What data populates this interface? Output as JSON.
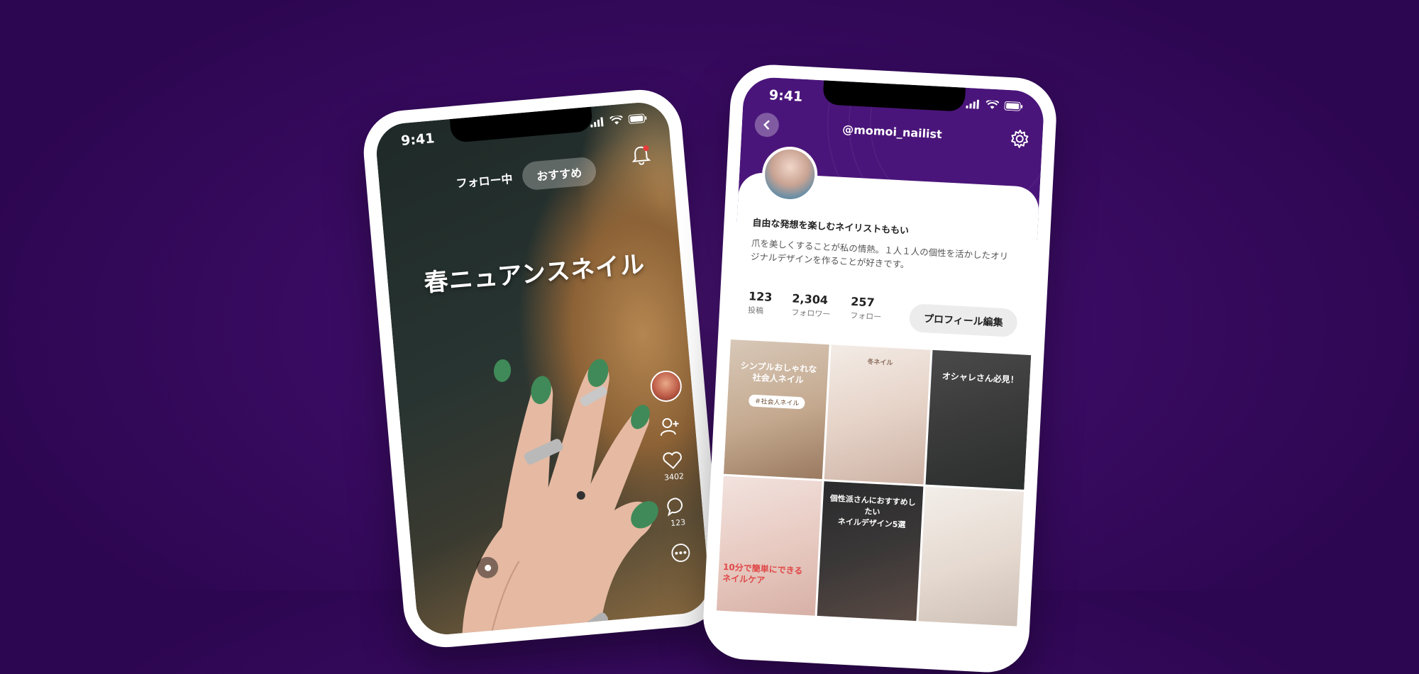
{
  "feed_phone": {
    "status_time": "9:41",
    "tabs": {
      "following": "フォロー中",
      "recommended": "おすすめ"
    },
    "post_title": "春ニュアンスネイル",
    "actions": {
      "like_count": "3402",
      "comment_count": "123"
    }
  },
  "profile_phone": {
    "status_time": "9:41",
    "username": "@momoi_nailist",
    "display_name": "自由な発想を楽しむネイリストももい",
    "bio": "爪を美しくすることが私の情熱。１人１人の個性を活かしたオリジナルデザインを作ることが好きです。",
    "stats": [
      {
        "value": "123",
        "label": "投稿"
      },
      {
        "value": "2,304",
        "label": "フォロワー"
      },
      {
        "value": "257",
        "label": "フォロー"
      }
    ],
    "edit_button": "プロフィール編集",
    "posts": [
      {
        "caption": "シンプルおしゃれな\n社会人ネイル",
        "tag": "＃社会人ネイル"
      },
      {
        "caption": "冬ネイル"
      },
      {
        "caption": "オシャレさん必見！"
      },
      {
        "caption": "10分で簡単にできる\nネイルケア"
      },
      {
        "caption": "個性派さんにおすすめしたい\nネイルデザイン5選"
      },
      {
        "caption": ""
      }
    ]
  }
}
